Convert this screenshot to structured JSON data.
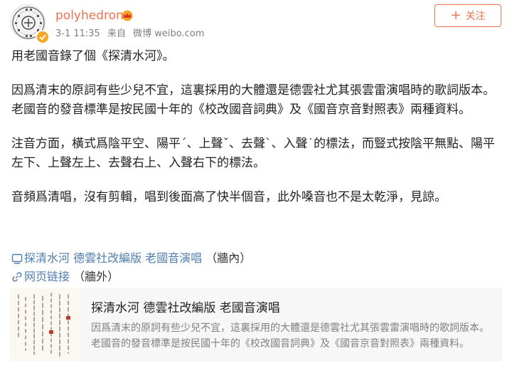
{
  "author": {
    "name": "polyhedron",
    "avatar_icon": "seal-stamp-avatar",
    "verified_icon": "verified-badge-icon",
    "member_icon": "crown-icon"
  },
  "meta": {
    "time": "3-1 11:35",
    "source_prefix": "来自",
    "source": "微博 weibo.com"
  },
  "follow_button": {
    "icon": "+",
    "label": "关注"
  },
  "post": {
    "paragraphs": [
      "用老國音錄了個《探清水河》。",
      "因爲清末的原詞有些少兒不宜，這裏採用的大體還是德雲社尤其張雲雷演唱時的歌詞版本。老國音的發音標準是按民國十年的《校改國音詞典》及《國音京音對照表》兩種資料。",
      "注音方面，橫式爲陰平空、陽平ˊ、上聲ˇ、去聲ˋ、入聲˙的標法，而豎式按陰平無點、陽平左下、上聲左上、去聲右上、入聲右下的標法。",
      "音頻爲清唱，沒有剪輯，唱到後面高了快半個音，此外嗓音也不是太乾淨，見諒。"
    ]
  },
  "links": [
    {
      "icon": "video-link-icon",
      "label": "探清水河 德雲社改編版 老國音演唱",
      "note": "（牆內）"
    },
    {
      "icon": "chain-link-icon",
      "label": "网页链接",
      "note": "（牆外）"
    }
  ],
  "card": {
    "title": "探清水河 德雲社改編版 老國音演唱",
    "description": "因爲清末的原詞有些少兒不宜，這裏採用的大體還是德雲社尤其張雲雷演唱時的歌詞版本。老國音的發音標準是按民國十年的《校改國音詞典》及《國音京音對照表》兩種資料。"
  },
  "colors": {
    "username": "#eb7350",
    "link": "#507daf",
    "meta": "#808080",
    "verified": "#f6a623"
  }
}
